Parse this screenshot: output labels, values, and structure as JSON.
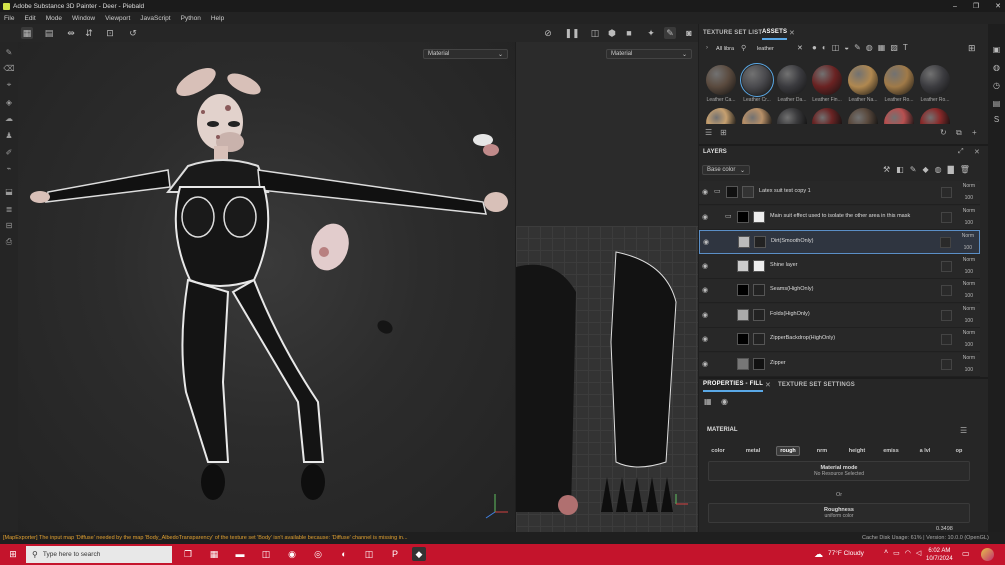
{
  "window": {
    "title": "Adobe Substance 3D Painter - Deer - Piebald",
    "minimize": "–",
    "maximize": "❐",
    "close": "✕"
  },
  "menu": [
    "File",
    "Edit",
    "Mode",
    "Window",
    "Viewport",
    "JavaScript",
    "Python",
    "Help"
  ],
  "viewport": {
    "left_dropdown": "Material",
    "right_dropdown": "Material"
  },
  "texture_panel": {
    "tab_texture_set_list": "TEXTURE SET LIST",
    "tab_assets": "ASSETS",
    "breadcrumb": "All libra",
    "search_value": "leather",
    "assets": [
      {
        "label": "Leather Ca...",
        "color": "#5a4a3e"
      },
      {
        "label": "Leather Cr...",
        "color": "#4a4a4e"
      },
      {
        "label": "Leather Da...",
        "color": "#3a3a3e"
      },
      {
        "label": "Leather Fin...",
        "color": "#6a2222"
      },
      {
        "label": "Leather Na...",
        "color": "#b08850"
      },
      {
        "label": "Leather Ro...",
        "color": "#a07a48"
      },
      {
        "label": "Leather Ro...",
        "color": "#3c3c40"
      }
    ],
    "assets_row2": [
      "#c6a070",
      "#b89068",
      "#3c3c3e",
      "#6a2424",
      "#5a4a3e",
      "#b85050",
      "#8a2a2a"
    ]
  },
  "layers_panel": {
    "title": "LAYERS",
    "channel": "Base color",
    "layers": [
      {
        "name": "Latex suit test copy 1",
        "blend": "Norm",
        "opacity": "100"
      },
      {
        "name": "Main suit effect used to isolate the other area in this mask",
        "blend": "Norm",
        "opacity": "100"
      },
      {
        "name": "Dirt(SmoothOnly)",
        "blend": "Norm",
        "opacity": "100"
      },
      {
        "name": "Shine layer",
        "blend": "Norm",
        "opacity": "100"
      },
      {
        "name": "Seams(HighOnly)",
        "blend": "Norm",
        "opacity": "100"
      },
      {
        "name": "Folds(HighOnly)",
        "blend": "Norm",
        "opacity": "100"
      },
      {
        "name": "ZipperBackdrop(HighOnly)",
        "blend": "Norm",
        "opacity": "100"
      },
      {
        "name": "Zipper",
        "blend": "Norm",
        "opacity": "100"
      }
    ]
  },
  "properties_panel": {
    "tab_properties": "PROPERTIES - FILL",
    "tab_texture_settings": "TEXTURE SET SETTINGS",
    "section": "MATERIAL",
    "channels": [
      "color",
      "metal",
      "rough",
      "nrm",
      "height",
      "emiss",
      "a lvl",
      "op"
    ],
    "material_mode_title": "Material mode",
    "material_mode_value": "No Resource Selected",
    "or": "Or",
    "roughness_title": "Roughness",
    "roughness_value": "uniform color",
    "value_readout": "0.3498"
  },
  "status": {
    "error": "[MapExporter] The input map 'Diffuse' needed by the map 'Body_AlbedoTransparency' of the texture set 'Body' isn't available because: 'Diffuse' channel is missing in...",
    "cache": "Cache Disk Usage:   61% | Version: 10.0.0 (OpenGL)"
  },
  "taskbar": {
    "search_placeholder": "Type here to search",
    "weather": "77°F  Cloudy",
    "time": "6:02 AM",
    "date": "10/7/2024"
  }
}
